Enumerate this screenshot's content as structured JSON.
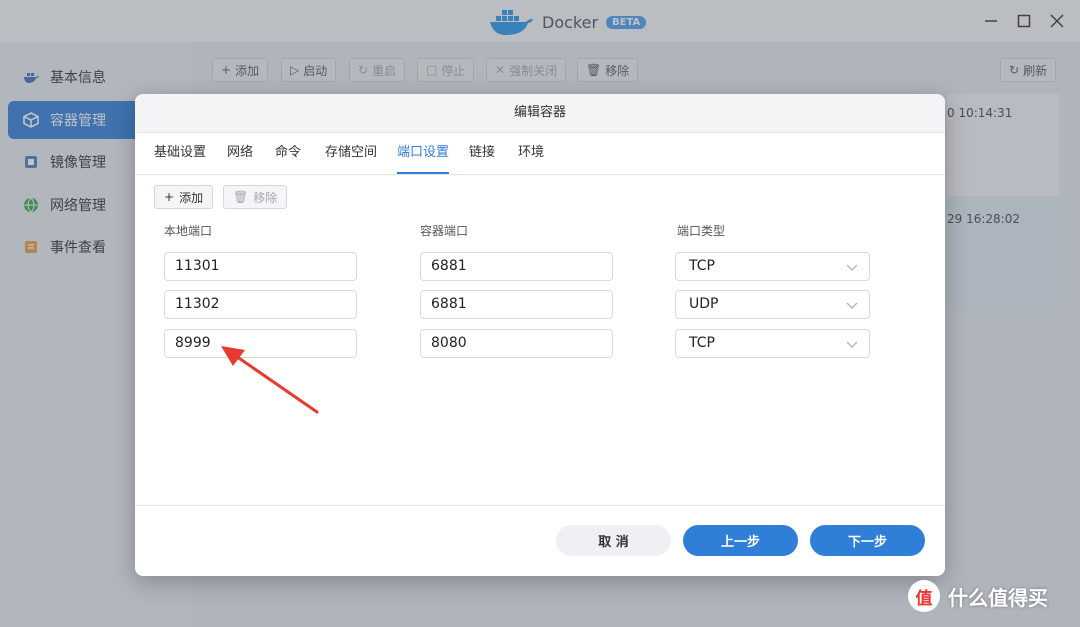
{
  "window": {
    "app_name": "Docker",
    "badge": "BETA"
  },
  "sidebar": {
    "items": [
      {
        "label": "基本信息",
        "icon": "docker-whale-icon"
      },
      {
        "label": "容器管理",
        "icon": "container-box-icon",
        "active": true
      },
      {
        "label": "镜像管理",
        "icon": "image-layers-icon"
      },
      {
        "label": "网络管理",
        "icon": "globe-icon"
      },
      {
        "label": "事件查看",
        "icon": "event-log-icon"
      }
    ]
  },
  "toolbar": {
    "add": "添加",
    "start": "启动",
    "restart": "重启",
    "stop": "停止",
    "force_close": "强制关闭",
    "remove": "移除",
    "refresh": "刷新"
  },
  "background_cards": [
    {
      "timestamp": "0 10:14:31"
    },
    {
      "timestamp": "29 16:28:02"
    }
  ],
  "dialog": {
    "title": "编辑容器",
    "tabs": [
      {
        "label": "基础设置"
      },
      {
        "label": "网络"
      },
      {
        "label": "命令"
      },
      {
        "label": "存储空间"
      },
      {
        "label": "端口设置",
        "active": true
      },
      {
        "label": "链接"
      },
      {
        "label": "环境"
      }
    ],
    "add_label": "添加",
    "remove_label": "移除",
    "columns": {
      "local_port": "本地端口",
      "container_port": "容器端口",
      "port_type": "端口类型"
    },
    "rows": [
      {
        "local_port": "11301",
        "container_port": "6881",
        "port_type": "TCP"
      },
      {
        "local_port": "11302",
        "container_port": "6881",
        "port_type": "UDP"
      },
      {
        "local_port": "8999",
        "container_port": "8080",
        "port_type": "TCP"
      }
    ],
    "buttons": {
      "cancel": "取 消",
      "prev": "上一步",
      "next": "下一步"
    }
  },
  "watermark": {
    "icon_text": "值",
    "text": "什么值得买"
  },
  "colors": {
    "accent": "#2f7ed8",
    "arrow": "#e8392f"
  }
}
